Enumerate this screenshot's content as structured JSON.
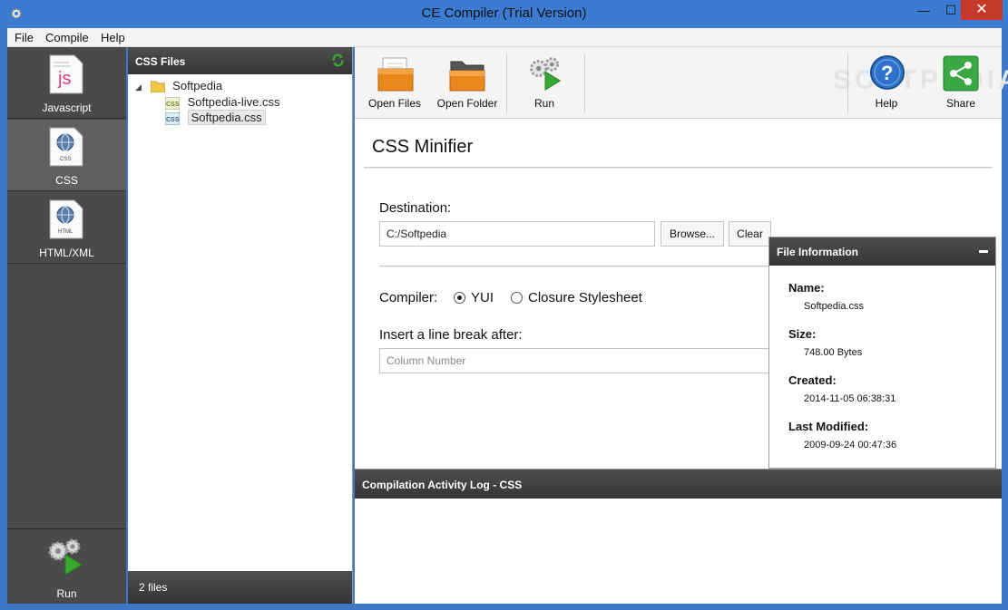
{
  "window": {
    "title": "CE Compiler (Trial Version)"
  },
  "menu": [
    "File",
    "Compile",
    "Help"
  ],
  "sidebar": {
    "items": [
      {
        "label": "Javascript",
        "icon": "js-file-icon"
      },
      {
        "label": "CSS",
        "icon": "css-file-icon"
      },
      {
        "label": "HTML/XML",
        "icon": "html-file-icon"
      }
    ],
    "run_label": "Run"
  },
  "files_panel": {
    "title": "CSS Files",
    "folder": "Softpedia",
    "files": [
      "Softpedia-live.css",
      "Softpedia.css"
    ],
    "selected": "Softpedia.css",
    "footer": "2 files"
  },
  "toolbar": {
    "open_files": "Open Files",
    "open_folder": "Open Folder",
    "run": "Run",
    "help": "Help",
    "share": "Share",
    "watermark": "SOFTPEDIA"
  },
  "minifier": {
    "title": "CSS Minifier",
    "destination_label": "Destination:",
    "destination_value": "C:/Softpedia",
    "browse_label": "Browse...",
    "clear_label": "Clear",
    "compiler_label": "Compiler:",
    "compiler_options": [
      "YUI",
      "Closure Stylesheet"
    ],
    "compiler_selected": "YUI",
    "linebreak_label": "Insert a line break after:",
    "linebreak_placeholder": "Column Number"
  },
  "file_info": {
    "title": "File Information",
    "name_label": "Name:",
    "name_value": "Softpedia.css",
    "size_label": "Size:",
    "size_value": "748.00 Bytes",
    "created_label": "Created:",
    "created_value": "2014-11-05 06:38:31",
    "modified_label": "Last Modified:",
    "modified_value": "2009-09-24 00:47:36"
  },
  "log": {
    "title": "Compilation Activity Log - CSS"
  },
  "colors": {
    "titlebar": "#3b7bd2",
    "sidebar": "#4a4a4a",
    "close": "#c73a2a",
    "accent_green": "#3aa832"
  }
}
